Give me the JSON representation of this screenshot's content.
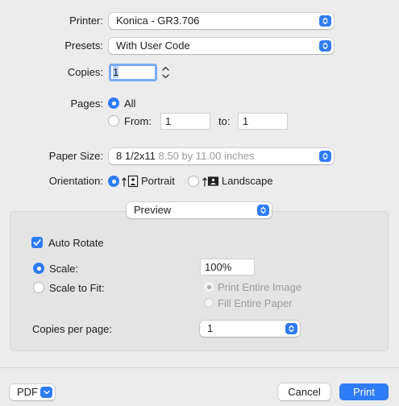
{
  "printer": {
    "label": "Printer:",
    "value": "Konica - GR3.706"
  },
  "presets": {
    "label": "Presets:",
    "value": "With User Code"
  },
  "copies": {
    "label": "Copies:",
    "value": "1"
  },
  "pages": {
    "label": "Pages:",
    "all_label": "All",
    "from_label": "From:",
    "from_value": "1",
    "to_label": "to:",
    "to_value": "1",
    "selected": "All"
  },
  "paper_size": {
    "label": "Paper Size:",
    "value": "8 1/2x11",
    "detail": "8.50 by 11.00 inches"
  },
  "orientation": {
    "label": "Orientation:",
    "portrait_label": "Portrait",
    "landscape_label": "Landscape",
    "selected": "Portrait"
  },
  "section": {
    "menu_value": "Preview",
    "auto_rotate_label": "Auto Rotate",
    "auto_rotate_checked": true,
    "scale_label": "Scale:",
    "scale_value": "100%",
    "scale_to_fit_label": "Scale to Fit:",
    "print_entire_image_label": "Print Entire Image",
    "fill_entire_paper_label": "Fill Entire Paper",
    "copies_per_page_label": "Copies per page:",
    "copies_per_page_value": "1"
  },
  "footer": {
    "pdf_label": "PDF",
    "cancel_label": "Cancel",
    "print_label": "Print"
  },
  "colors": {
    "accent": "#2f7cf6",
    "background": "#ececec"
  }
}
